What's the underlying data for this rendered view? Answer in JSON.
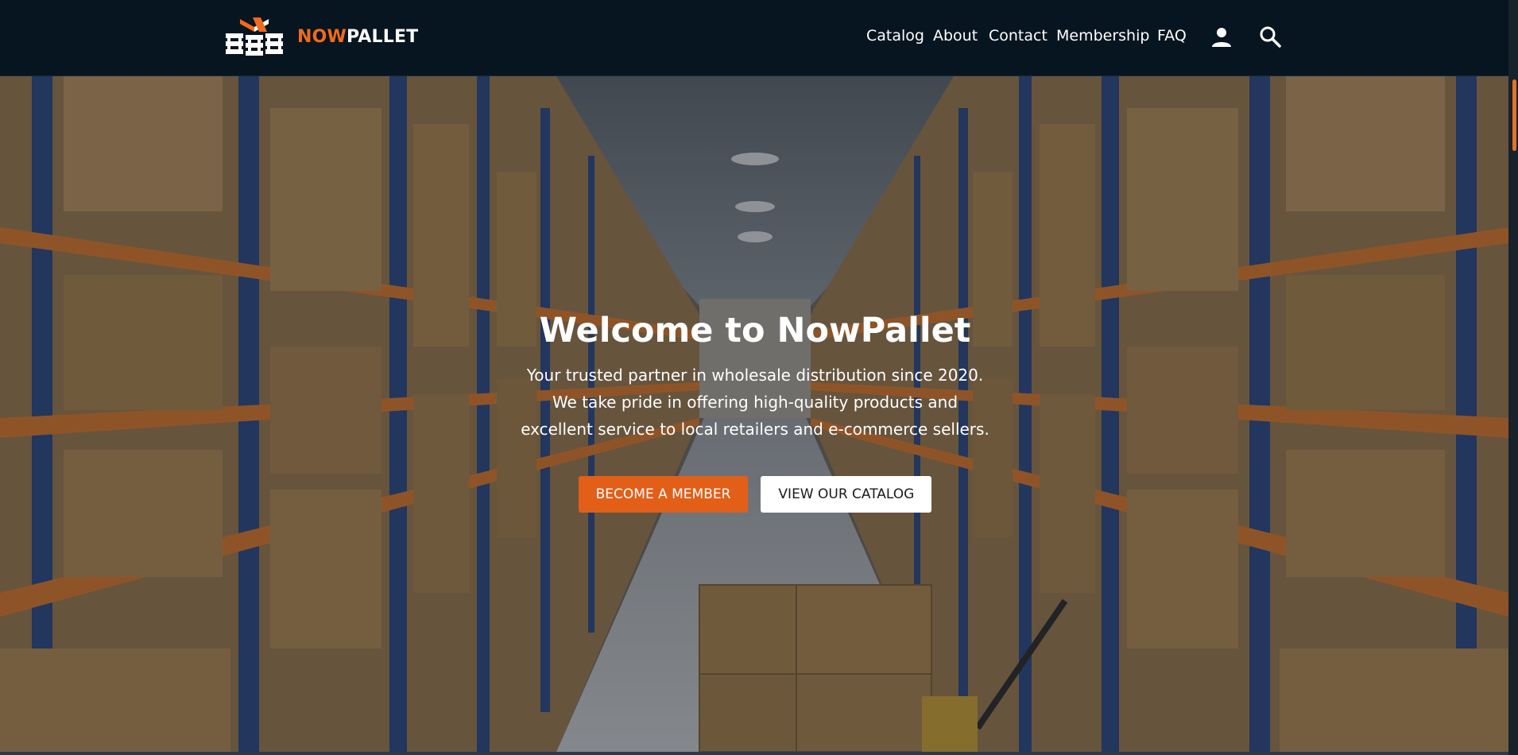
{
  "brand": {
    "name_part1": "NOW",
    "name_part2": "PALLET",
    "logo_icon": "pallet-logo-icon"
  },
  "nav": {
    "items": [
      {
        "label": "Catalog"
      },
      {
        "label": "About"
      },
      {
        "label": "Contact"
      },
      {
        "label": "Membership"
      },
      {
        "label": "FAQ"
      }
    ],
    "account_icon": "user-icon",
    "search_icon": "search-icon"
  },
  "hero": {
    "title": "Welcome to NowPallet",
    "subtitle": "Your trusted partner in wholesale distribution since 2020. We take pride in offering high-quality products and excellent service to local retailers and e-commerce sellers.",
    "primary_button": "BECOME A MEMBER",
    "secondary_button": "VIEW OUR CATALOG",
    "background": "warehouse-aisle-image"
  },
  "colors": {
    "accent": "#e35f17",
    "header_bg": "#071520",
    "text": "#ffffff"
  }
}
